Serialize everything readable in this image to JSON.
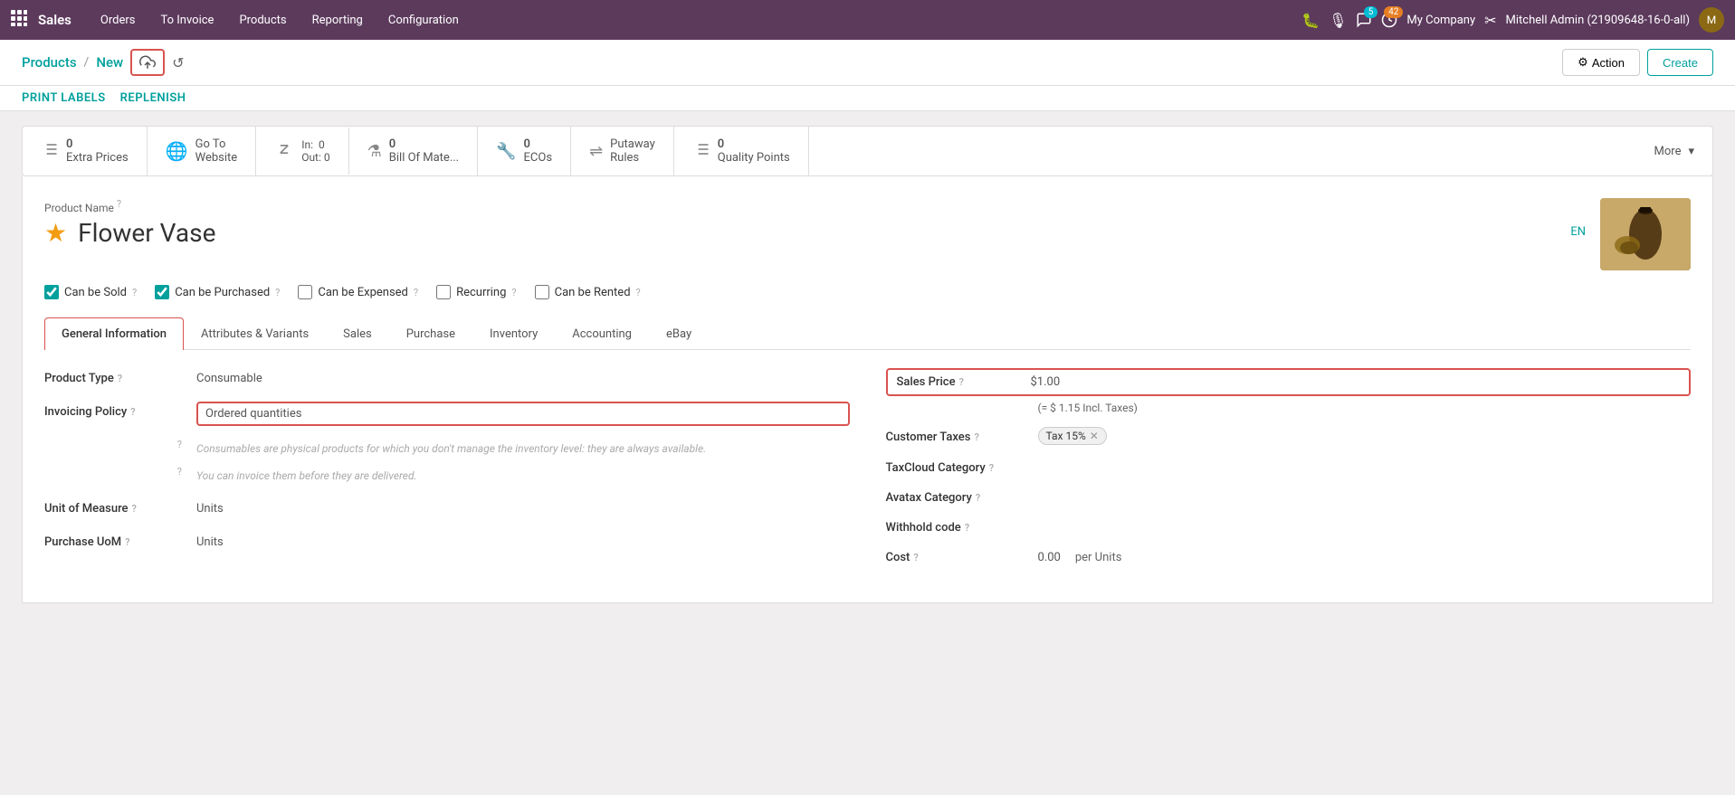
{
  "topnav": {
    "app_title": "Sales",
    "nav_items": [
      "Orders",
      "To Invoice",
      "Products",
      "Reporting",
      "Configuration"
    ],
    "badge_messages": "5",
    "badge_activity": "42",
    "company": "My Company",
    "user": "Mitchell Admin (21909648-16-0-all)"
  },
  "breadcrumb": {
    "path": "Products",
    "separator": "/",
    "current": "New"
  },
  "toolbar": {
    "action_label": "Action",
    "create_label": "Create"
  },
  "sub_nav": {
    "items": [
      "Print Labels",
      "Replenish"
    ]
  },
  "smart_buttons": [
    {
      "icon": "list",
      "count": "0",
      "label": "Extra Prices"
    },
    {
      "icon": "globe",
      "label": "Go To Website"
    },
    {
      "icon": "arrows",
      "in_label": "In:",
      "in_val": "0",
      "out_label": "Out:",
      "out_val": "0"
    },
    {
      "icon": "flask",
      "count": "0",
      "label": "Bill Of Mate..."
    },
    {
      "icon": "wrench",
      "count": "0",
      "label": "ECOs"
    },
    {
      "icon": "shuffle",
      "label": "Putaway Rules"
    },
    {
      "icon": "quality",
      "count": "0",
      "label": "Quality Points"
    },
    {
      "icon": "more",
      "label": "More"
    }
  ],
  "product": {
    "name_label": "Product Name",
    "name": "Flower Vase",
    "lang": "EN",
    "checkboxes": [
      {
        "label": "Can be Sold",
        "checked": true
      },
      {
        "label": "Can be Purchased",
        "checked": true
      },
      {
        "label": "Can be Expensed",
        "checked": false
      },
      {
        "label": "Recurring",
        "checked": false
      },
      {
        "label": "Can be Rented",
        "checked": false
      }
    ]
  },
  "tabs": [
    {
      "label": "General Information",
      "active": true
    },
    {
      "label": "Attributes & Variants"
    },
    {
      "label": "Sales"
    },
    {
      "label": "Purchase"
    },
    {
      "label": "Inventory"
    },
    {
      "label": "Accounting"
    },
    {
      "label": "eBay"
    }
  ],
  "general_info": {
    "left": {
      "product_type_label": "Product Type",
      "product_type_value": "Consumable",
      "invoicing_policy_label": "Invoicing Policy",
      "invoicing_policy_value": "Ordered quantities",
      "info_text1": "Consumables are physical products for which you don't manage the inventory level: they are always available.",
      "info_text2": "You can invoice them before they are delivered.",
      "unit_of_measure_label": "Unit of Measure",
      "unit_of_measure_value": "Units",
      "purchase_uom_label": "Purchase UoM",
      "purchase_uom_value": "Units"
    },
    "right": {
      "sales_price_label": "Sales Price",
      "sales_price_value": "$1.00",
      "incl_taxes": "(= $ 1.15 Incl. Taxes)",
      "customer_taxes_label": "Customer Taxes",
      "tax_badge": "Tax 15%",
      "taxcloud_label": "TaxCloud Category",
      "avatax_label": "Avatax Category",
      "withhold_label": "Withhold code",
      "cost_label": "Cost",
      "cost_value": "0.00",
      "per_units": "per Units"
    }
  }
}
